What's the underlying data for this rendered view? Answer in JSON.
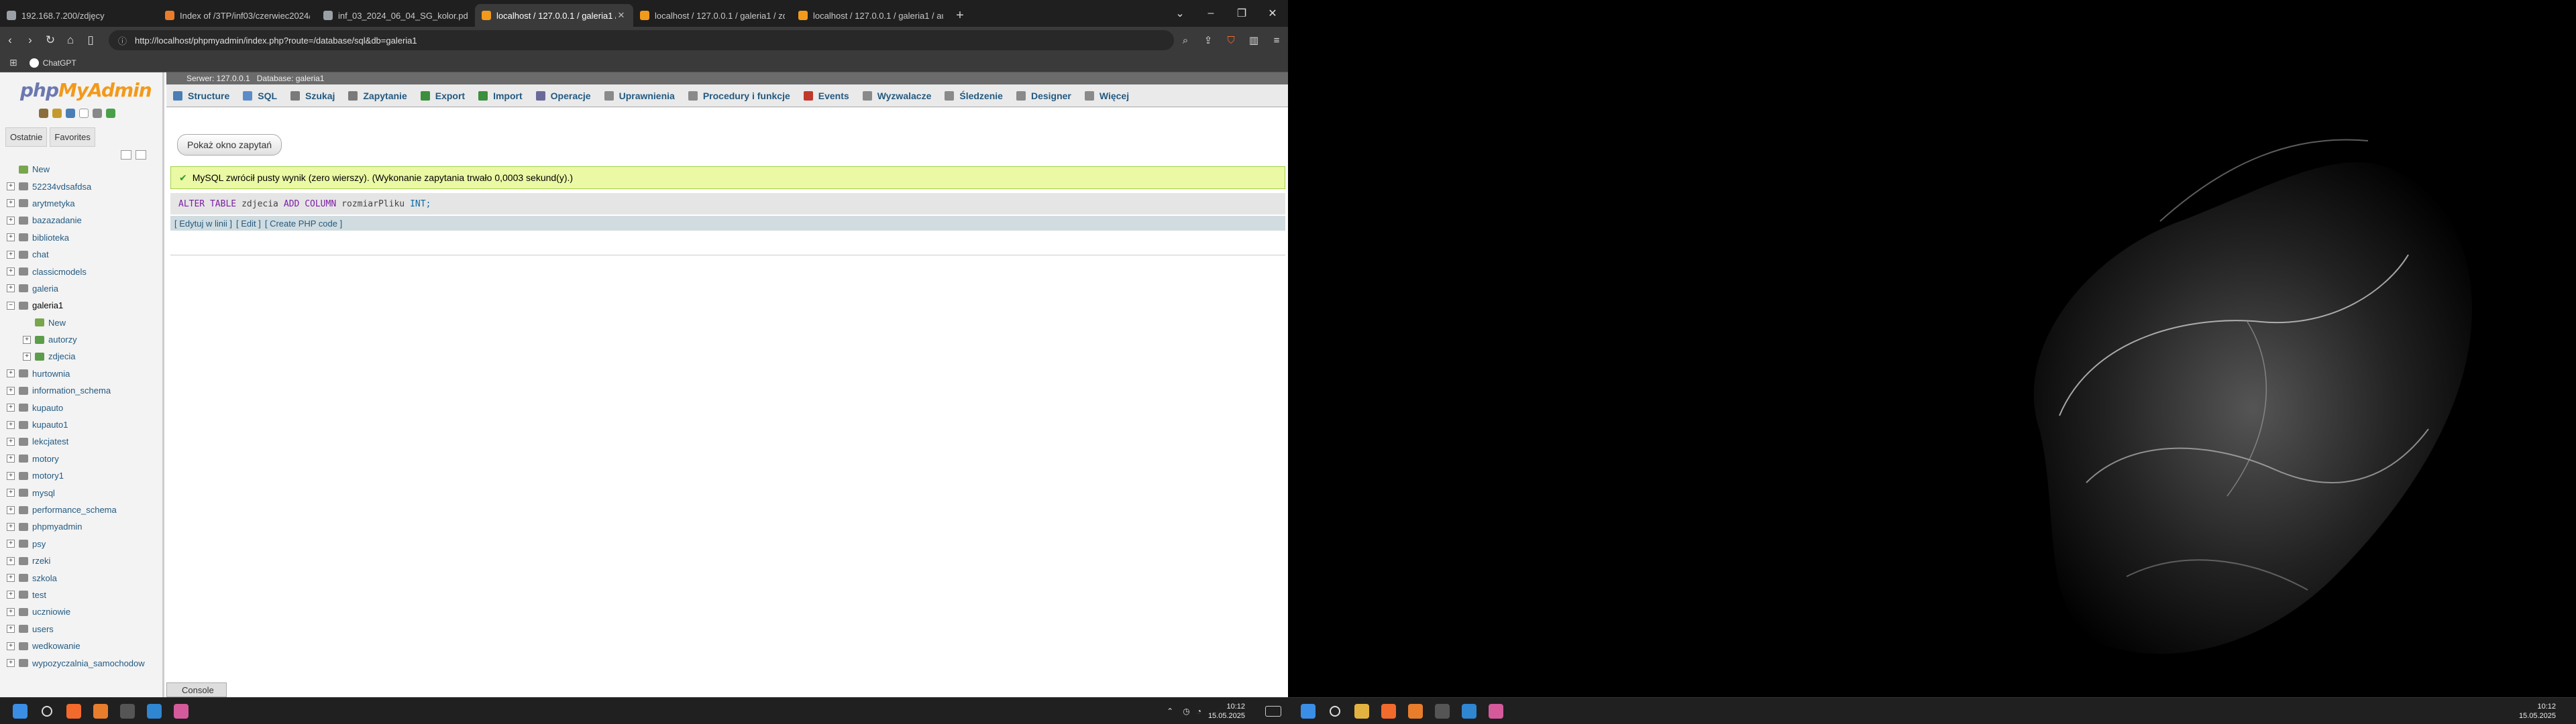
{
  "browser": {
    "tabs": [
      {
        "title": "192.168.7.200/zdjęcy",
        "fav_color": "#9aa0a6"
      },
      {
        "title": "Index of /3TP/inf03/czerwiec2024/",
        "fav_color": "#e87d2c"
      },
      {
        "title": "inf_03_2024_06_04_SG_kolor.pdf",
        "fav_color": "#9aa0a6"
      },
      {
        "title": "localhost / 127.0.0.1 / galeria1 /",
        "fav_color": "#f29a1c",
        "active": true
      },
      {
        "title": "localhost / 127.0.0.1 / galeria1 / zdj",
        "fav_color": "#f29a1c"
      },
      {
        "title": "localhost / 127.0.0.1 / galeria1 / aut",
        "fav_color": "#f29a1c"
      }
    ],
    "url": "http://localhost/phpmyadmin/index.php?route=/database/sql&db=galeria1",
    "bookmarks": [
      {
        "label": "ChatGPT"
      }
    ]
  },
  "pma": {
    "logo_main": "php",
    "logo_accent": "MyAdmin",
    "sidebar_tabs": [
      "Ostatnie",
      "Favorites"
    ],
    "tree": [
      {
        "label": "New",
        "kind": "new"
      },
      {
        "label": "52234vdsafdsa",
        "kind": "db"
      },
      {
        "label": "arytmetyka",
        "kind": "db"
      },
      {
        "label": "bazazadanie",
        "kind": "db"
      },
      {
        "label": "biblioteka",
        "kind": "db"
      },
      {
        "label": "chat",
        "kind": "db"
      },
      {
        "label": "classicmodels",
        "kind": "db"
      },
      {
        "label": "galeria",
        "kind": "db"
      },
      {
        "label": "galeria1",
        "kind": "db",
        "open": true
      },
      {
        "label": "New",
        "kind": "new",
        "sub": true
      },
      {
        "label": "autorzy",
        "kind": "table",
        "sub": true
      },
      {
        "label": "zdjecia",
        "kind": "table",
        "sub": true
      },
      {
        "label": "hurtownia",
        "kind": "db"
      },
      {
        "label": "information_schema",
        "kind": "db"
      },
      {
        "label": "kupauto",
        "kind": "db"
      },
      {
        "label": "kupauto1",
        "kind": "db"
      },
      {
        "label": "lekcjatest",
        "kind": "db"
      },
      {
        "label": "motory",
        "kind": "db"
      },
      {
        "label": "motory1",
        "kind": "db"
      },
      {
        "label": "mysql",
        "kind": "db"
      },
      {
        "label": "performance_schema",
        "kind": "db"
      },
      {
        "label": "phpmyadmin",
        "kind": "db"
      },
      {
        "label": "psy",
        "kind": "db"
      },
      {
        "label": "rzeki",
        "kind": "db"
      },
      {
        "label": "szkola",
        "kind": "db"
      },
      {
        "label": "test",
        "kind": "db"
      },
      {
        "label": "uczniowie",
        "kind": "db"
      },
      {
        "label": "users",
        "kind": "db"
      },
      {
        "label": "wedkowanie",
        "kind": "db"
      },
      {
        "label": "wypozyczalnia_samochodow",
        "kind": "db"
      }
    ],
    "breadcrumb": {
      "server": "Serwer: 127.0.0.1",
      "database": "Database: galeria1"
    },
    "menu": [
      {
        "label": "Structure",
        "color": "#4a7fb5"
      },
      {
        "label": "SQL",
        "color": "#5b8cc8"
      },
      {
        "label": "Szukaj",
        "color": "#7a7a7a"
      },
      {
        "label": "Zapytanie",
        "color": "#7a7a7a"
      },
      {
        "label": "Export",
        "color": "#3c8f3c"
      },
      {
        "label": "Import",
        "color": "#3c8f3c"
      },
      {
        "label": "Operacje",
        "color": "#6a6a9a"
      },
      {
        "label": "Uprawnienia",
        "color": "#8a8a8a"
      },
      {
        "label": "Procedury i funkcje",
        "color": "#8a8a8a"
      },
      {
        "label": "Events",
        "color": "#c0392b"
      },
      {
        "label": "Wyzwalacze",
        "color": "#8a8a8a"
      },
      {
        "label": "Śledzenie",
        "color": "#8a8a8a"
      },
      {
        "label": "Designer",
        "color": "#8a8a8a"
      },
      {
        "label": "Więcej",
        "color": "#8a8a8a"
      }
    ],
    "show_query_button": "Pokaż okno zapytań",
    "success_message": "MySQL zwrócił pusty wynik (zero wierszy). (Wykonanie zapytania trwało 0,0003 sekund(y).)",
    "sql": {
      "kw1": "ALTER TABLE",
      "tbl": "zdjecia",
      "kw2": "ADD COLUMN",
      "col": "rozmiarPliku",
      "type": "INT;"
    },
    "sql_links": [
      "[ Edytuj w linii ]",
      "[ Edit ]",
      "[ Create PHP code ]"
    ],
    "console_label": "Console"
  },
  "taskbar": {
    "time": "10:12",
    "date": "15.05.2025",
    "time_right": "10:12",
    "date_right": "15.05.2025"
  }
}
